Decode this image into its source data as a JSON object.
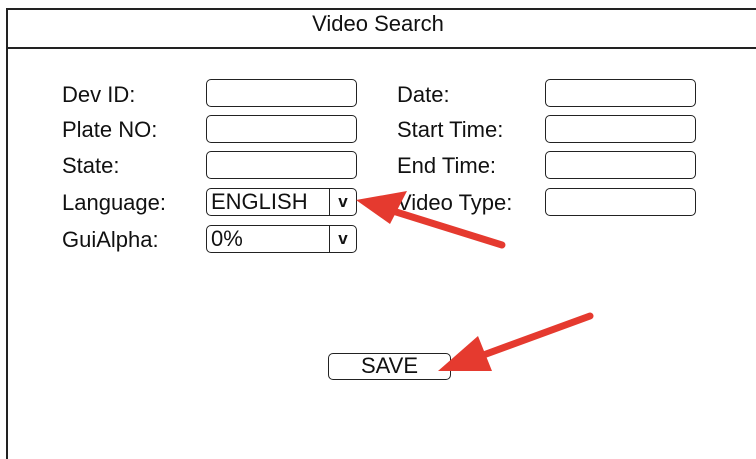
{
  "window": {
    "title": "Video Search"
  },
  "form": {
    "left": {
      "dev_id": {
        "label": "Dev ID:",
        "value": ""
      },
      "plate_no": {
        "label": "Plate NO:",
        "value": ""
      },
      "state": {
        "label": "State:",
        "value": ""
      },
      "language": {
        "label": "Language:",
        "selected": "ENGLISH",
        "arrow": "v"
      },
      "gui_alpha": {
        "label": "GuiAlpha:",
        "selected": "0%",
        "arrow": "v"
      }
    },
    "right": {
      "date": {
        "label": "Date:",
        "value": ""
      },
      "start_time": {
        "label": "Start Time:",
        "value": ""
      },
      "end_time": {
        "label": "End Time:",
        "value": ""
      },
      "video_type": {
        "label": "Video Type:",
        "value": ""
      }
    }
  },
  "actions": {
    "save_label": "SAVE"
  },
  "annotations": {
    "arrow_color": "#e53a2f"
  }
}
